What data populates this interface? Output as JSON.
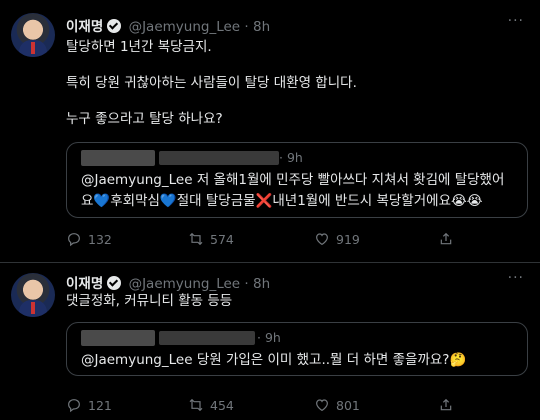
{
  "tweets": [
    {
      "name": "이재명",
      "handle": "@Jaemyung_Lee",
      "dot": "·",
      "time": "8h",
      "more": "···",
      "lines": [
        "탈당하면 1년간 복당금지.",
        "특히 당원 귀찮아하는 사람들이 탈당 대환영 합니다.",
        "누구 좋으라고 탈당 하나요?"
      ],
      "quote": {
        "dot": "·",
        "time": "9h",
        "mention": "@Jaemyung_Lee",
        "line1": " 저 올해1월에 민주당 빨아쓰다 지쳐서 홧김에 탈당했어",
        "line2_a": "요",
        "heart1": "💙",
        "line2_b": "후회막심",
        "heart2": "💙",
        "line2_c": "절대 탈당금물",
        "cross": "❌",
        "line2_d": "내년1월에 반드시 복당할거에요",
        "emoji": "😭😭"
      },
      "actions": {
        "reply": "132",
        "retweet": "574",
        "like": "919"
      }
    },
    {
      "name": "이재명",
      "handle": "@Jaemyung_Lee",
      "dot": "·",
      "time": "8h",
      "more": "···",
      "lines": [
        "댓글정화, 커뮤니티 활동 등등"
      ],
      "quote": {
        "dot": "·",
        "time": "9h",
        "mention": "@Jaemyung_Lee",
        "line1": " 당원 가입은 이미 했고..뭘 더 하면 좋을까요?",
        "emoji": "🤔"
      },
      "actions": {
        "reply": "121",
        "retweet": "454",
        "like": "801"
      }
    }
  ],
  "icons": [
    "reply-icon",
    "retweet-icon",
    "like-icon",
    "share-icon",
    "verified-icon",
    "more-icon"
  ]
}
